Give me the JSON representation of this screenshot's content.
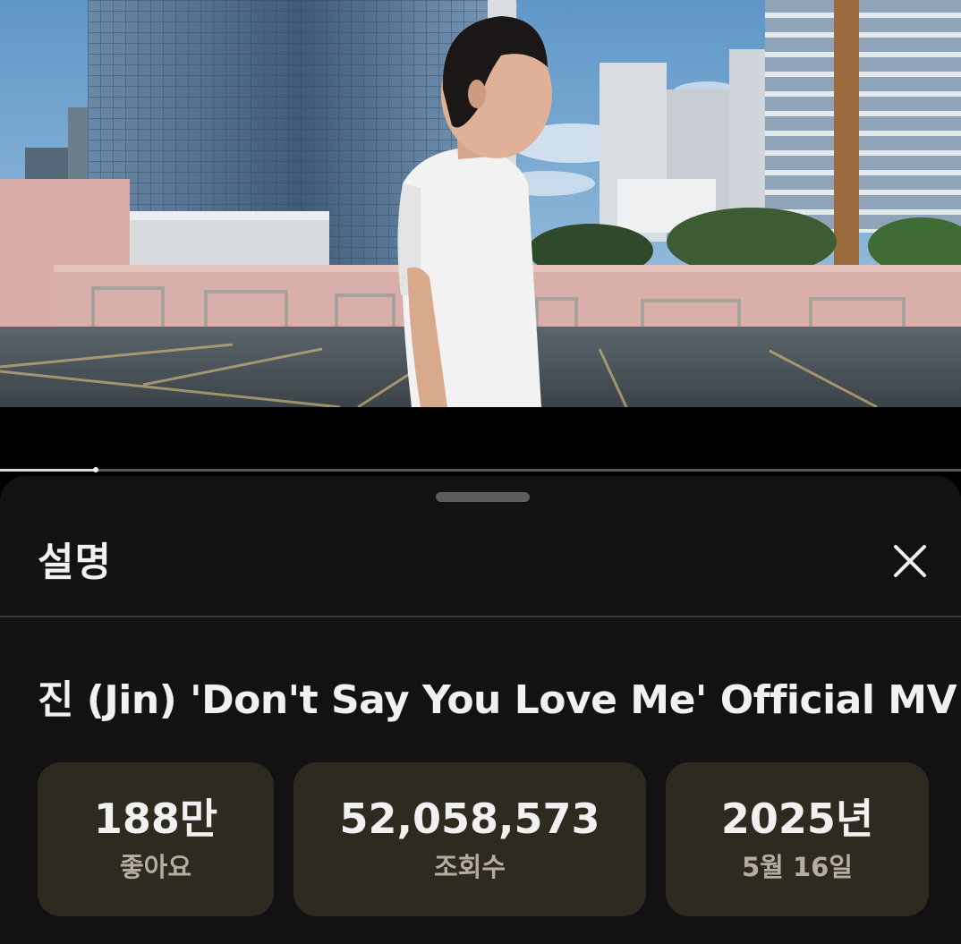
{
  "video": {
    "progress_fraction": 0.1
  },
  "description_sheet": {
    "title": "설명",
    "close_icon": "close-icon",
    "video_title": "진 (Jin) 'Don't Say You Love Me' Official MV",
    "stats": {
      "likes": {
        "value": "188만",
        "label": "좋아요"
      },
      "views": {
        "value": "52,058,573",
        "label": "조회수"
      },
      "date": {
        "value": "2025년",
        "label": "5월 16일"
      }
    }
  },
  "colors": {
    "sheet_background": "#121212",
    "stat_card_background": "#2f2a1f",
    "stat_label": "#b3ae9f",
    "text_primary": "#f1f1f1"
  }
}
